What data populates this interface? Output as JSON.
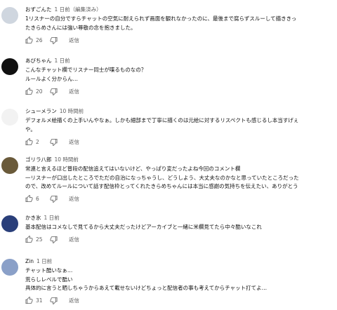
{
  "comments": [
    {
      "author": "おずごんた",
      "time": "1 日前（編集済み）",
      "lines": [
        "1リスナーの自分ですらチャットの空気に耐えられず画面を観れなかったのに、最後まで腐らずスルーして描ききっ",
        "たきらめさんには強い尊敬の念を抱きました。"
      ],
      "likes": "26",
      "reply_label": "返信",
      "avatar_color": "#cfd6df"
    },
    {
      "author": "あびちゃん",
      "time": "1 日前",
      "lines": [
        "こんなチャット欄でリスナー同士が喋るものなの？",
        "ルールよく分からん…"
      ],
      "likes": "20",
      "reply_label": "返信",
      "avatar_color": "#111111"
    },
    {
      "author": "シューメラン",
      "time": "10 時間前",
      "lines": [
        "デフォルメ絵描くの上手いんやなぁ。しかも細部まで丁寧に描くのは元絵に対するリスペクトも感じるし本当すげぇ",
        "や。"
      ],
      "likes": "2",
      "reply_label": "返信",
      "avatar_color": "#f2f2f2"
    },
    {
      "author": "ゴリラ八郎",
      "time": "10 時間前",
      "lines": [
        "常連と言えるほど普段の配信追えてはいないけど、やっぱり変だったよね今回のコメント欄",
        "一リスナーが口出したところでただの自治になっちゃうし、どうしよう、大丈夫なのかなと思っていたところだった",
        "ので、改めてルールについて話す配信枠とってくれたきらめちゃんには本当に感謝の気持ちを伝えたい、ありがとう"
      ],
      "likes": "6",
      "reply_label": "返信",
      "avatar_color": "#6a5a3a"
    },
    {
      "author": "かき氷",
      "time": "1 日前",
      "lines": [
        "基本配信はコメなしで見てるから大丈夫だったけどアーカイブと一緒に米欄見てたら中々酷いなこれ"
      ],
      "likes": "25",
      "reply_label": "返信",
      "avatar_color": "#2a3f7a"
    },
    {
      "author": "Zin",
      "time": "1 日前",
      "lines": [
        "チャット酷いなぁ…",
        "荒らしレベルで酷い",
        "具体的に言うと晒しちゃうからあえて載せないけどちょっと配信者の事も考えてからチャット打てよ…"
      ],
      "likes": "31",
      "reply_label": "返信",
      "avatar_color": "#8aa0c8"
    }
  ]
}
